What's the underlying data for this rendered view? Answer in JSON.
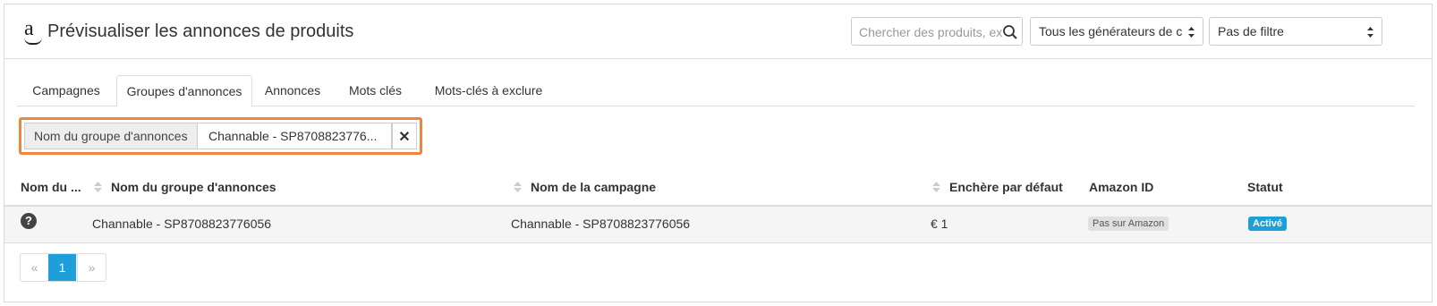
{
  "header": {
    "title": "Prévisualiser les annonces de produits",
    "logo_icon": "amazon-logo-icon",
    "search": {
      "value": "",
      "placeholder": "Chercher des produits, ex",
      "icon": "search-icon"
    },
    "generator_select": {
      "value": "Tous les générateurs de c"
    },
    "filter_select": {
      "value": "Pas de filtre"
    }
  },
  "tabs": [
    {
      "label": "Campagnes",
      "active": false
    },
    {
      "label": "Groupes d'annonces",
      "active": true
    },
    {
      "label": "Annonces",
      "active": false
    },
    {
      "label": "Mots clés",
      "active": false
    },
    {
      "label": "Mots-clés à exclure",
      "active": false
    }
  ],
  "active_filter": {
    "label": "Nom du groupe d'annonces",
    "value": "Channable - SP8708823776...",
    "remove": "✕"
  },
  "table": {
    "columns": [
      "Nom du ...",
      "Nom du groupe d'annonces",
      "Nom de la campagne",
      "Enchère par défaut",
      "Amazon ID",
      "Statut"
    ],
    "rows": [
      {
        "icon": "question-icon",
        "icon_glyph": "?",
        "ad_group": "Channable - SP8708823776056",
        "campaign": "Channable - SP8708823776056",
        "bid": "€ 1",
        "amazon_id": "Pas sur Amazon",
        "status": "Activé"
      }
    ]
  },
  "pagination": {
    "prev": "«",
    "current": "1",
    "next": "»"
  },
  "colors": {
    "accent": "#1e9fd9",
    "highlight_border": "#f0853e"
  }
}
